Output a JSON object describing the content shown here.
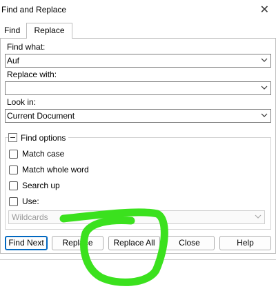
{
  "window": {
    "title": "Find and Replace"
  },
  "tabs": [
    {
      "label": "Find"
    },
    {
      "label": "Replace"
    }
  ],
  "find_what": {
    "label": "Find what:",
    "value": "Auf"
  },
  "replace_with": {
    "label": "Replace with:",
    "value": ""
  },
  "look_in": {
    "label": "Look in:",
    "value": "Current Document"
  },
  "find_options": {
    "label": "Find options",
    "match_case": "Match case",
    "match_whole_word": "Match whole word",
    "search_up": "Search up",
    "use": "Use:",
    "wildcards": "Wildcards"
  },
  "buttons": {
    "find_next": "Find Next",
    "replace": "Replace",
    "replace_all": "Replace All",
    "close": "Close",
    "help": "Help"
  },
  "colors": {
    "annotation": "#3be11e",
    "accent": "#0067c0"
  }
}
